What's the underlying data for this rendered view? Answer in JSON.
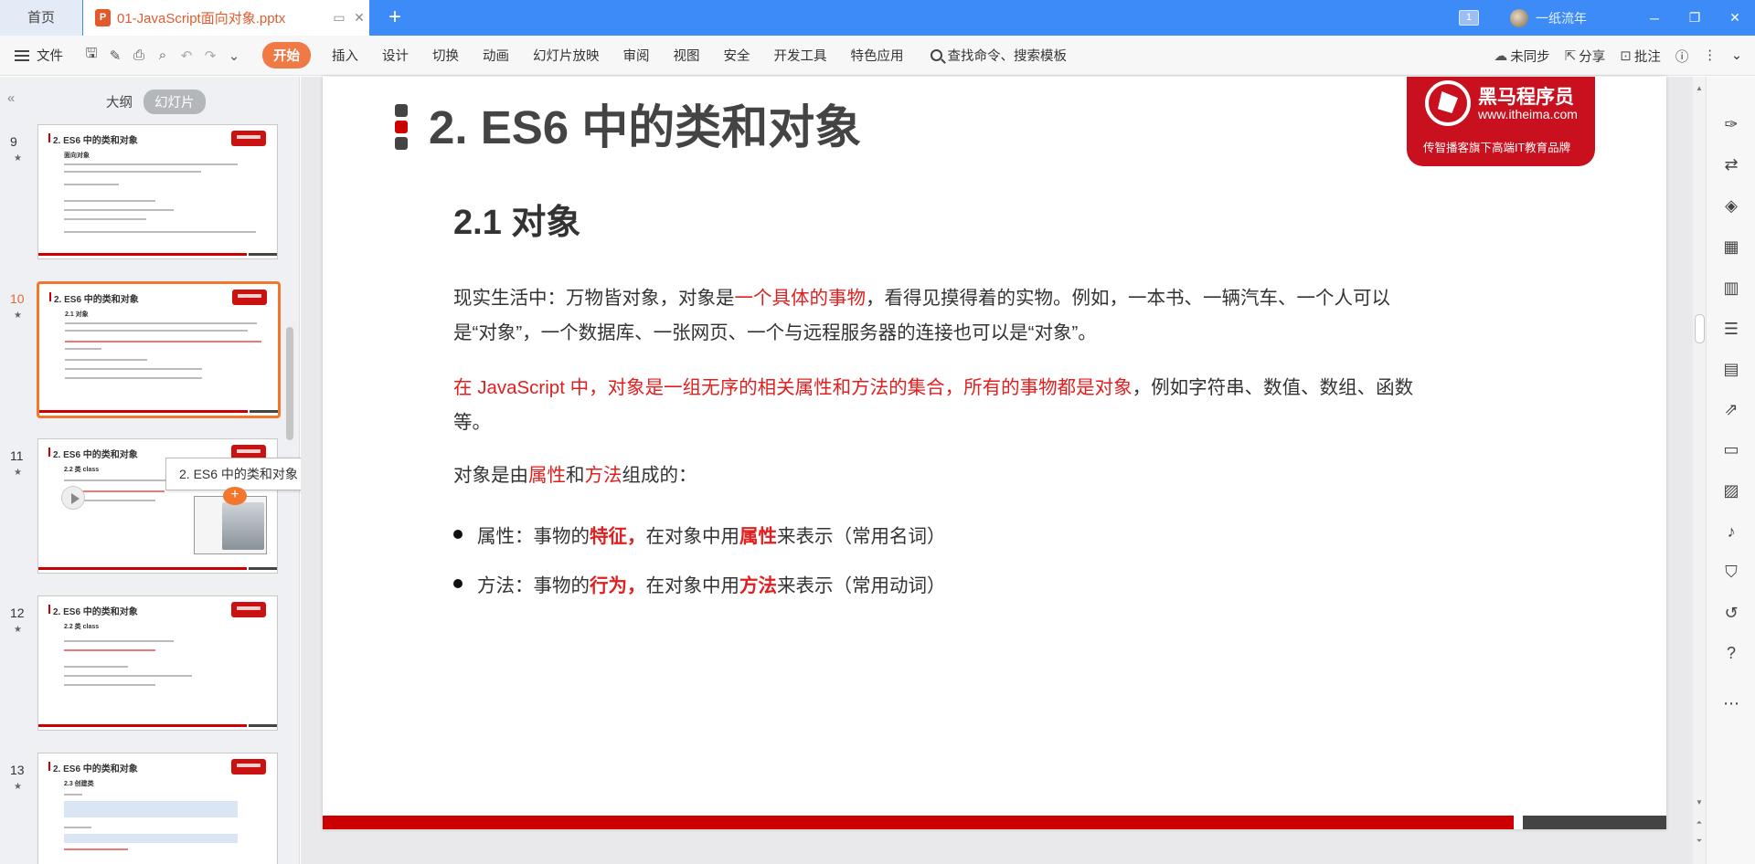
{
  "titlebar": {
    "home_tab": "首页",
    "doc_tab": "01-JavaScript面向对象.pptx",
    "doc_icon": "P",
    "window_count": "1",
    "user_name": "一纸流年",
    "accent_color": "#3d8bf7"
  },
  "menubar": {
    "file": "文件",
    "items": [
      "开始",
      "插入",
      "设计",
      "切换",
      "动画",
      "幻灯片放映",
      "审阅",
      "视图",
      "安全",
      "开发工具",
      "特色应用"
    ],
    "search": "查找命令、搜索模板",
    "sync": "未同步",
    "share": "分享",
    "comment": "批注",
    "active_color": "#f07a45"
  },
  "left_panel": {
    "tab_outline": "大纲",
    "tab_slides": "幻灯片",
    "tooltip": "2. ES6 中的类和对象",
    "thumbnails": [
      {
        "num": "9",
        "title": "2. ES6 中的类和对象",
        "subtitle": "面向对象"
      },
      {
        "num": "10",
        "title": "2. ES6 中的类和对象",
        "subtitle": "2.1 对象"
      },
      {
        "num": "11",
        "title": "2. ES6 中的类和对象",
        "subtitle": "2.2 类 class"
      },
      {
        "num": "12",
        "title": "2. ES6 中的类和对象",
        "subtitle": "2.2 类 class"
      },
      {
        "num": "13",
        "title": "2. ES6 中的类和对象",
        "subtitle": "2.3 创建类"
      }
    ]
  },
  "slide": {
    "title": "2. ES6 中的类和对象",
    "logo_name": "黑马程序员",
    "logo_url": "www.itheima.com",
    "logo_tagline": "传智播客旗下高端IT教育品牌",
    "subtitle": "2.1 对象",
    "p1_a": "现实生活中：万物皆对象，对象是",
    "p1_red": "一个具体的事物",
    "p1_b": "，看得见摸得着的实物。例如，一本书、一辆汽车、一个人可以是“对象”，一个数据库、一张网页、一个与远程服务器的连接也可以是“对象”。",
    "p2_red": "在 JavaScript 中，对象是一组无序的相关属性和方法的集合，所有的事物都是对象",
    "p2_b": "，例如字符串、数值、数组、函数等。",
    "p3_a": "对象是由",
    "p3_r1": "属性",
    "p3_b": "和",
    "p3_r2": "方法",
    "p3_c": "组成的：",
    "bullet1_a": "属性：事物的",
    "bullet1_r1": "特征，",
    "bullet1_b": "在对象中用",
    "bullet1_r2": "属性",
    "bullet1_c": "来表示（常用名词）",
    "bullet2_a": "方法：事物的",
    "bullet2_r1": "行为，",
    "bullet2_b": "在对象中用",
    "bullet2_r2": "方法",
    "bullet2_c": "来表示（常用动词）",
    "brand_color": "#c00000"
  }
}
